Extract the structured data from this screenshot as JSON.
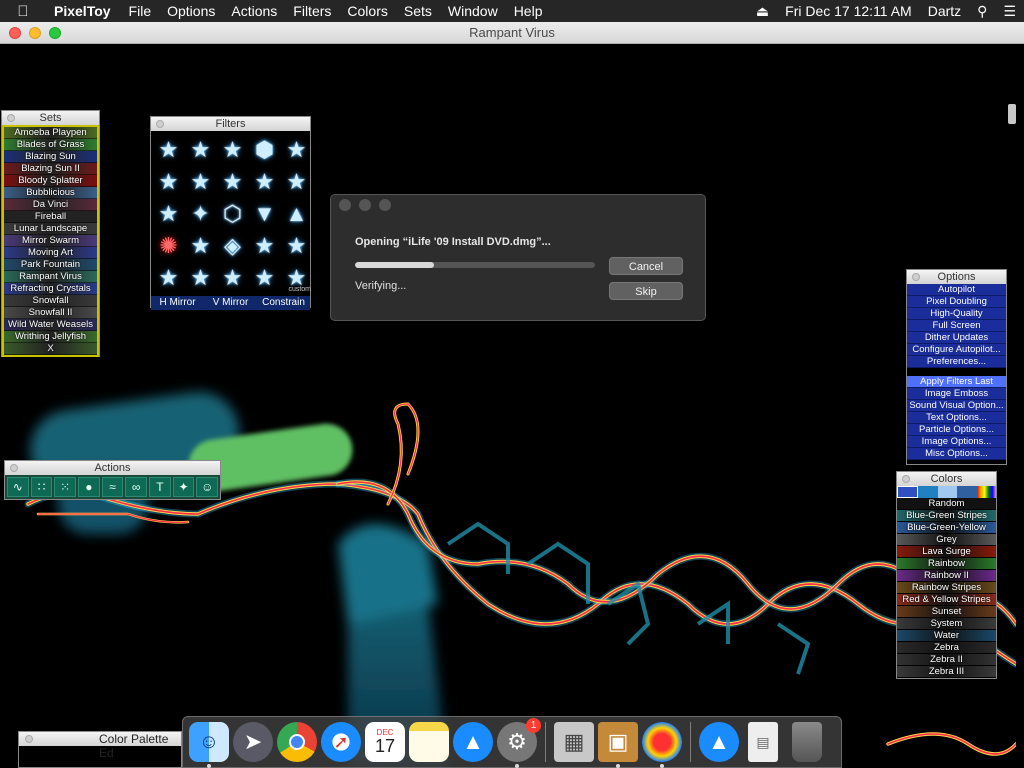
{
  "menubar": {
    "app_name": "PixelToy",
    "menus": [
      "File",
      "Options",
      "Actions",
      "Filters",
      "Colors",
      "Sets",
      "Window",
      "Help"
    ],
    "clock": "Fri Dec 17  12:11 AM",
    "user": "Dartz"
  },
  "window": {
    "title": "Rampant Virus"
  },
  "sets_palette": {
    "title": "Sets",
    "items": [
      {
        "label": "Amoeba Playpen",
        "color": "#4d6a22"
      },
      {
        "label": "Blades of Grass",
        "color": "#2f7d2f"
      },
      {
        "label": "Blazing Sun",
        "color": "#1c2f7a"
      },
      {
        "label": "Blazing Sun II",
        "color": "#6a1a1a"
      },
      {
        "label": "Bloody Splatter",
        "color": "#7a0f0f"
      },
      {
        "label": "Bubblicious",
        "color": "#3a5f8a"
      },
      {
        "label": "Da Vinci",
        "color": "#5a2a3a"
      },
      {
        "label": "Fireball",
        "color": "#222222"
      },
      {
        "label": "Lunar Landscape",
        "color": "#3a3a3a"
      },
      {
        "label": "Mirror Swarm",
        "color": "#4b3a7a"
      },
      {
        "label": "Moving Art",
        "color": "#2c3a8a"
      },
      {
        "label": "Park Fountain",
        "color": "#1f4a6a"
      },
      {
        "label": "Rampant Virus",
        "color": "#2a6a5a"
      },
      {
        "label": "Refracting Crystals",
        "color": "#2a3a8a"
      },
      {
        "label": "Snowfall",
        "color": "#3a3a3a"
      },
      {
        "label": "Snowfall II",
        "color": "#4a4a4a"
      },
      {
        "label": "Wild Water Weasels",
        "color": "#2a2a5a"
      },
      {
        "label": "Writhing Jellyfish",
        "color": "#3a6a2a"
      },
      {
        "label": "X",
        "color": "#3a5a2a"
      }
    ]
  },
  "filters_palette": {
    "title": "Filters",
    "cell_label": "custom",
    "buttons": [
      "H Mirror",
      "V Mirror",
      "Constrain"
    ]
  },
  "actions_palette": {
    "title": "Actions",
    "icons": [
      "wave-icon",
      "dots-icon",
      "speckle-icon",
      "bubbles-icon",
      "noise-icon",
      "swirl-icon",
      "text-icon",
      "sparkle-icon",
      "portrait-icon"
    ],
    "text_glyph": "T"
  },
  "options_palette": {
    "title": "Options",
    "items": [
      "Autopilot",
      "Pixel Doubling",
      "High-Quality",
      "Full Screen",
      "Dither Updates",
      "Configure Autopilot...",
      "Preferences..."
    ],
    "items2": [
      "Apply Filters Last",
      "Image Emboss",
      "Sound Visual Option...",
      "Text Options...",
      "Particle Options...",
      "Image Options...",
      "Misc Options..."
    ]
  },
  "colors_palette": {
    "title": "Colors",
    "items": [
      {
        "label": "Random",
        "color": "#111111"
      },
      {
        "label": "Blue-Green Stripes",
        "color": "#1f6a6a"
      },
      {
        "label": "Blue-Green-Yellow",
        "color": "#2a5a9a"
      },
      {
        "label": "Grey",
        "color": "#5a5a5a"
      },
      {
        "label": "Lava Surge",
        "color": "#8a1a0a"
      },
      {
        "label": "Rainbow",
        "color": "#2a7a2a"
      },
      {
        "label": "Rainbow II",
        "color": "#6a2a8a"
      },
      {
        "label": "Rainbow Stripes",
        "color": "#6a4a1a"
      },
      {
        "label": "Red & Yellow Stripes",
        "color": "#8a2a1a"
      },
      {
        "label": "Sunset",
        "color": "#6a3a1a"
      },
      {
        "label": "System",
        "color": "#3a3a3a"
      },
      {
        "label": "Water",
        "color": "#1a4a6a"
      },
      {
        "label": "Zebra",
        "color": "#2a2a2a"
      },
      {
        "label": "Zebra II",
        "color": "#333333"
      },
      {
        "label": "Zebra III",
        "color": "#3a3a3a"
      }
    ]
  },
  "dialog": {
    "title": "Opening “iLife '09 Install DVD.dmg”...",
    "status": "Verifying...",
    "progress": 0.33,
    "cancel_label": "Cancel",
    "skip_label": "Skip"
  },
  "color_palette_editor": {
    "title": "Color Palette Ed"
  },
  "dock": {
    "calendar_month": "DEC",
    "calendar_day": "17",
    "badge_count": "1",
    "apps": [
      "finder-icon",
      "launchpad-icon",
      "chrome-icon",
      "safari-icon",
      "calendar-icon",
      "notes-icon",
      "app-store-icon",
      "system-preferences-icon",
      "archive-icon",
      "slideshow-icon",
      "pixeltoy-icon",
      "app-store-alt-icon",
      "document-icon",
      "trash-icon"
    ]
  }
}
